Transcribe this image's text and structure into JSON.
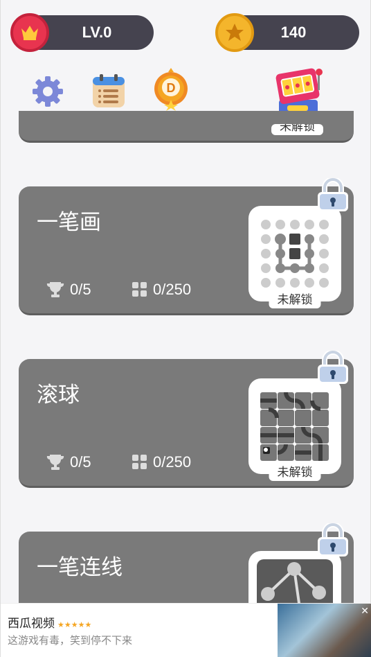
{
  "header": {
    "level_text": "LV.0",
    "coin_count": "140"
  },
  "top_icons": {
    "settings": "gear-icon",
    "tasks": "calendar-list-icon",
    "daily": "d-medal-icon",
    "slot": "slot-machine-icon"
  },
  "cards": [
    {
      "title": "一笔画",
      "trophies": "0/5",
      "levels": "0/250",
      "status": "未解锁"
    },
    {
      "title": "滚球",
      "trophies": "0/5",
      "levels": "0/250",
      "status": "未解锁"
    },
    {
      "title": "一笔连线"
    }
  ],
  "partial_card_status": "未解锁",
  "ad": {
    "title": "西瓜视频",
    "stars": "★★★★★",
    "subtitle": "这游戏有毒，笑到停不下来",
    "close": "✕"
  },
  "colors": {
    "pill_bg": "#45434f",
    "card_bg": "#7a7a7a",
    "crown_badge": "#e8344f",
    "coin_badge": "#f4b52c",
    "lock_blue": "#2f4a6e"
  }
}
